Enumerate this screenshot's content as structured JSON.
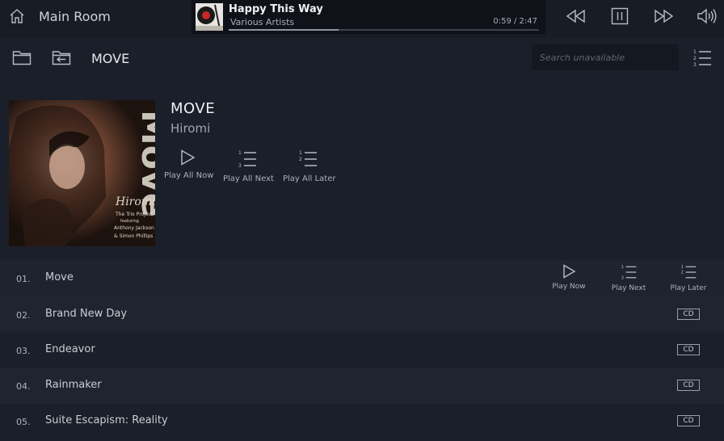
{
  "header": {
    "room": "Main Room",
    "icons": [
      "home-icon",
      "previous-icon",
      "pause-icon",
      "next-icon",
      "volume-icon"
    ]
  },
  "now_playing": {
    "title": "Happy This Way",
    "artist": "Various Artists",
    "time": "0:59 / 2:47",
    "progress": 0.353
  },
  "nav": {
    "title": "MOVE",
    "search_placeholder": "Search unavailable",
    "icons": [
      "folder-icon",
      "back-icon",
      "queue-icon"
    ]
  },
  "album": {
    "title": "MOVE",
    "artist": "Hiromi",
    "cover_text": {
      "big": "Move",
      "script": "Hiromi",
      "line1": "The Trio Project",
      "line2": "featuring",
      "line3": "Anthony Jackson",
      "line4": "& Simon Phillips"
    },
    "actions": [
      {
        "label": "Play All Now"
      },
      {
        "label": "Play All Next"
      },
      {
        "label": "Play All Later"
      }
    ]
  },
  "track_actions": [
    {
      "label": "Play Now"
    },
    {
      "label": "Play Next"
    },
    {
      "label": "Play Later"
    }
  ],
  "tracks": [
    {
      "num": "01.",
      "name": "Move",
      "badge": ""
    },
    {
      "num": "02.",
      "name": "Brand New Day",
      "badge": "CD"
    },
    {
      "num": "03.",
      "name": "Endeavor",
      "badge": "CD"
    },
    {
      "num": "04.",
      "name": "Rainmaker",
      "badge": "CD"
    },
    {
      "num": "05.",
      "name": "Suite Escapism: Reality",
      "badge": "CD"
    }
  ],
  "colors": {
    "background": "#1b1f29",
    "topbar": "#181c24",
    "now_playing_bg": "#0f1218",
    "row_alt": "#20242e",
    "text": "#d6d9e0"
  }
}
